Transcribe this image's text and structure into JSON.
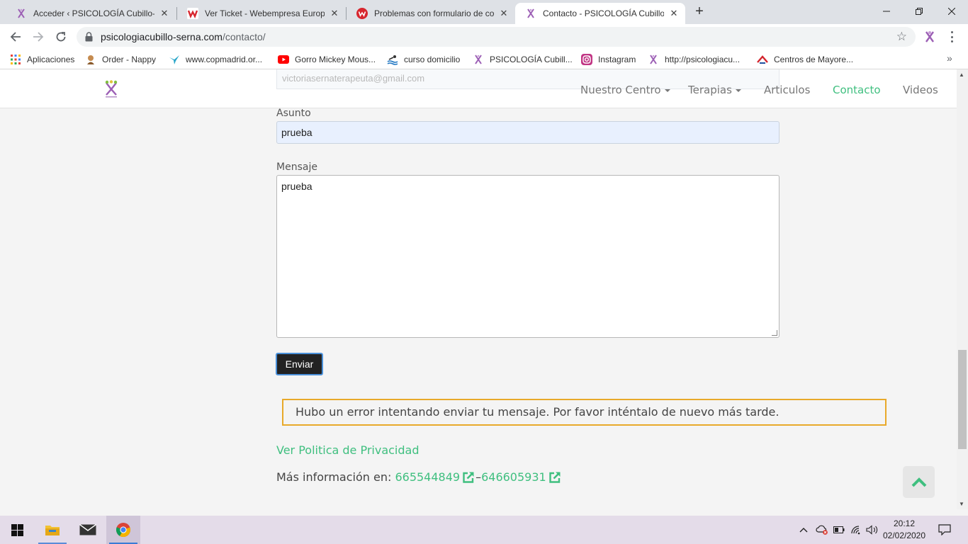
{
  "browser": {
    "tabs": [
      {
        "title": "Acceder ‹ PSICOLOGÍA Cubillo-Se",
        "icon": "site-logo-icon",
        "active": false
      },
      {
        "title": "Ver Ticket - Webempresa Europa",
        "icon": "webempresa-icon",
        "active": false
      },
      {
        "title": "Problemas con formulario de cor",
        "icon": "webempresa-round-icon",
        "active": false
      },
      {
        "title": "Contacto - PSICOLOGÍA Cubillo-S",
        "icon": "site-logo-icon",
        "active": true
      }
    ],
    "close_glyph": "✕",
    "new_tab_glyph": "+",
    "url_domain": "psicologiacubillo-serna.com",
    "url_path": "/contacto/",
    "bookmarks": [
      {
        "label": "Aplicaciones",
        "icon": "apps-grid-icon"
      },
      {
        "label": "Order - Nappy",
        "icon": "nappy-icon"
      },
      {
        "label": "www.copmadrid.or...",
        "icon": "bird-icon"
      },
      {
        "label": "Gorro Mickey Mous...",
        "icon": "youtube-icon"
      },
      {
        "label": "curso domicilio",
        "icon": "swim-icon"
      },
      {
        "label": "PSICOLOGÍA Cubill...",
        "icon": "site-logo-icon"
      },
      {
        "label": "Instagram",
        "icon": "instagram-icon"
      },
      {
        "label": "http://psicologiacu...",
        "icon": "site-logo-icon"
      },
      {
        "label": "Centros de Mayore...",
        "icon": "mayores-icon"
      }
    ],
    "bookmarks_more": "»"
  },
  "site": {
    "nav": [
      {
        "label": "Nuestro Centro",
        "dropdown": true,
        "active": false
      },
      {
        "label": "Terapias",
        "dropdown": true,
        "active": false
      },
      {
        "label": "Articulos",
        "dropdown": false,
        "active": false
      },
      {
        "label": "Contacto",
        "dropdown": false,
        "active": true
      },
      {
        "label": "Videos",
        "dropdown": false,
        "active": false
      }
    ],
    "accent_color": "#3fbf7f"
  },
  "form": {
    "email_value": "victoriasernaterapeuta@gmail.com",
    "asunto_label": "Asunto",
    "asunto_value": "prueba",
    "mensaje_label": "Mensaje",
    "mensaje_value": "prueba",
    "send_label": "Enviar",
    "error_message": "Hubo un error intentando enviar tu mensaje. Por favor inténtalo de nuevo más tarde.",
    "error_color": "#e8a92a"
  },
  "footer_info": {
    "privacy_link": "Ver Politica de Privacidad",
    "more_info_label": "Más información en: ",
    "phone1": "665544849",
    "separator": "–",
    "phone2": "646605931"
  },
  "taskbar": {
    "time": "20:12",
    "date": "02/02/2020"
  }
}
